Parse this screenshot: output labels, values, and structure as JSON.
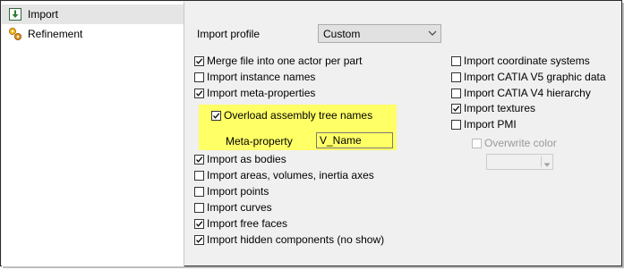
{
  "sidebar": {
    "items": [
      {
        "label": "Import",
        "icon": "import-arrow-icon",
        "selected": true
      },
      {
        "label": "Refinement",
        "icon": "refinement-icon",
        "selected": false
      }
    ]
  },
  "profile": {
    "label": "Import profile",
    "value": "Custom"
  },
  "left_options": [
    {
      "label": "Merge file into one actor per part",
      "checked": true
    },
    {
      "label": "Import instance names",
      "checked": false
    },
    {
      "label": "Import meta-properties",
      "checked": true
    }
  ],
  "overload": {
    "label": "Overload assembly tree names",
    "checked": true
  },
  "meta_property": {
    "label": "Meta-property",
    "value": "V_Name"
  },
  "left_options_2": [
    {
      "label": "Import as bodies",
      "checked": true
    },
    {
      "label": "Import areas, volumes, inertia axes",
      "checked": false
    },
    {
      "label": "Import points",
      "checked": false
    },
    {
      "label": "Import curves",
      "checked": false
    },
    {
      "label": "Import free faces",
      "checked": true
    },
    {
      "label": "Import hidden components (no show)",
      "checked": true
    }
  ],
  "right_options": [
    {
      "label": "Import coordinate systems",
      "checked": false
    },
    {
      "label": "Import CATIA V5 graphic data",
      "checked": false
    },
    {
      "label": "Import CATIA V4 hierarchy",
      "checked": false
    },
    {
      "label": "Import textures",
      "checked": true
    },
    {
      "label": "Import PMI",
      "checked": false
    }
  ],
  "overwrite_color": {
    "label": "Overwrite color",
    "checked": false,
    "enabled": false
  },
  "colors": {
    "highlight": "#ffff66",
    "sidebar_selected": "#e5e5e5",
    "panel_bg": "#f0f0f0"
  }
}
